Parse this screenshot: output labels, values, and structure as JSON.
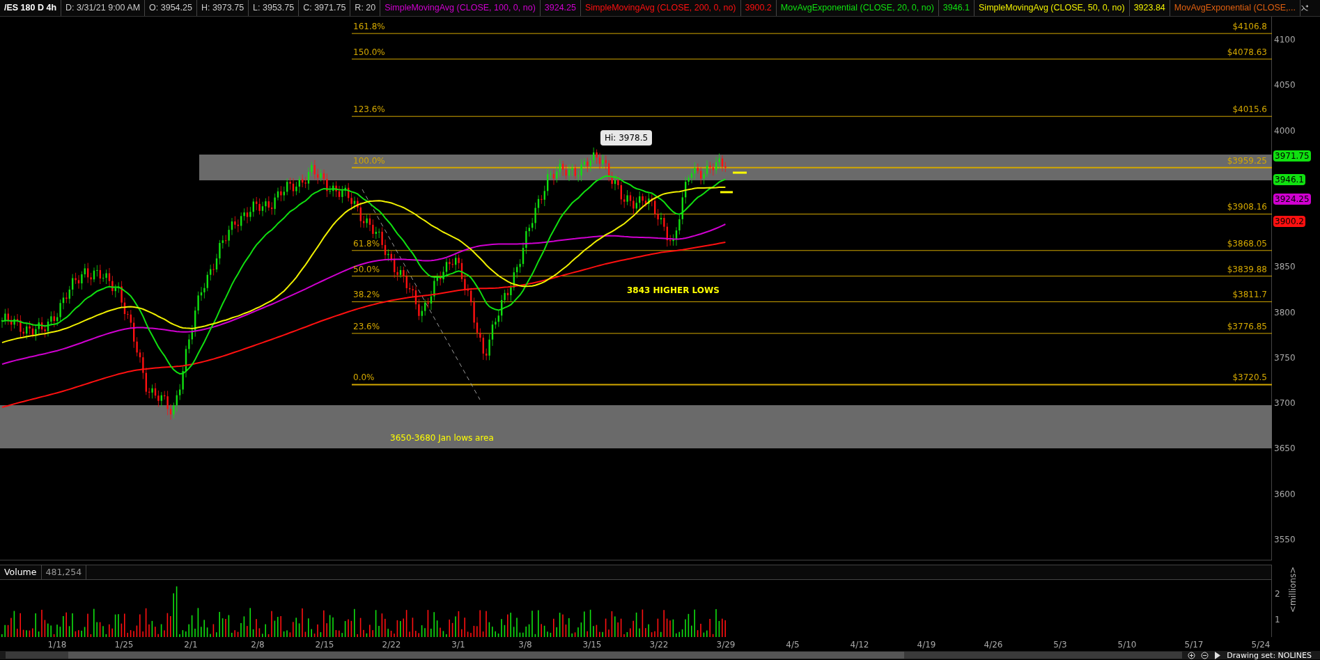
{
  "header": {
    "symbol": "/ES 180 D 4h",
    "fields": [
      "D: 3/31/21 9:00 AM",
      "O: 3954.25",
      "H: 3973.75",
      "L: 3953.75",
      "C: 3971.75",
      "R: 20"
    ]
  },
  "studies": [
    {
      "label": "SimpleMovingAvg (CLOSE, 100, 0, no)",
      "value": "3924.25",
      "color": "#d000d0"
    },
    {
      "label": "SimpleMovingAvg (CLOSE, 200, 0, no)",
      "value": "3900.2",
      "color": "#ff1010"
    },
    {
      "label": "MovAvgExponential (CLOSE, 20, 0, no)",
      "value": "3946.1",
      "color": "#10e010"
    },
    {
      "label": "SimpleMovingAvg (CLOSE, 50, 0, no)",
      "value": "3923.84",
      "color": "#f0f000"
    },
    {
      "label": "MovAvgExponential (CLOSE,...",
      "color": "#e06010"
    }
  ],
  "price_chart": {
    "fib_levels": [
      {
        "percent": "161.8%",
        "price": "$4106.8"
      },
      {
        "percent": "150.0%",
        "price": "$4078.63"
      },
      {
        "percent": "123.6%",
        "price": "$4015.6"
      },
      {
        "percent": "100.0%",
        "price": "$3959.25"
      },
      {
        "price": "$3908.16"
      },
      {
        "percent": "61.8%",
        "price": "$3868.05"
      },
      {
        "percent": "50.0%",
        "price": "$3839.88"
      },
      {
        "percent": "38.2%",
        "price": "$3811.7"
      },
      {
        "percent": "23.6%",
        "price": "$3776.85"
      },
      {
        "percent": "0.0%",
        "price": "$3720.5"
      }
    ],
    "high_label": "Hi: 3978.5",
    "higher_lows_note": "3843 HIGHER LOWS",
    "zone_note": "3650-3680 Jan lows area"
  },
  "price_axis": {
    "ticks": [
      "4100",
      "4050",
      "4000",
      "3850",
      "3800",
      "3750",
      "3700",
      "3650",
      "3600",
      "3550"
    ],
    "badges": [
      {
        "value": "3971.75",
        "color": "#10e010"
      },
      {
        "value": "3946.1",
        "color": "#10e010"
      },
      {
        "value": "3924.25",
        "color": "#d000d0"
      },
      {
        "value": "3900.2",
        "color": "#ff1010"
      }
    ]
  },
  "volume": {
    "title": "Volume",
    "value": "481,254",
    "ticks": [
      "2",
      "1"
    ],
    "unit": "<millions>"
  },
  "x_axis": {
    "ticks": [
      "1/18",
      "1/25",
      "2/1",
      "2/8",
      "2/15",
      "2/22",
      "3/1",
      "3/8",
      "3/15",
      "3/22",
      "3/29",
      "4/5",
      "4/12",
      "4/19",
      "4/26",
      "5/3",
      "5/10",
      "5/17",
      "5/24"
    ]
  },
  "status": {
    "drawing_set": "Drawing set: NOLINES"
  }
}
